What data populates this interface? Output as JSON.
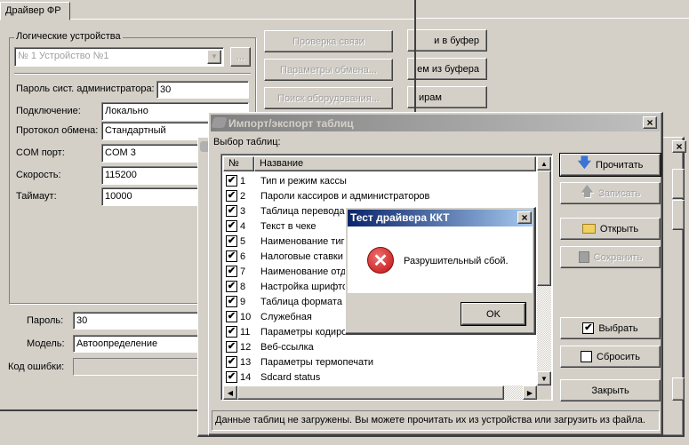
{
  "main_window": {
    "tab": "Драйвер ФР",
    "group_title": "Логические устройства",
    "device_combo": "№ 1 Устройство №1",
    "ellipsis_button": "...",
    "admin_password_label": "Пароль сист. администратора:",
    "admin_password": "30",
    "connection_label": "Подключение:",
    "connection": "Локально",
    "protocol_label": "Протокол обмена:",
    "protocol": "Стандартный",
    "com_label": "COM порт:",
    "com": "COM 3",
    "speed_label": "Скорость:",
    "speed": "115200",
    "timeout_label": "Таймаут:",
    "timeout": "10000",
    "buttons": [
      "Проверка связи",
      "Параметры обмена...",
      "Поиск оборудования..."
    ],
    "password_label": "Пароль:",
    "password": "30",
    "model_label": "Модель:",
    "model": "Автоопределение",
    "error_code_label": "Код ошибки:",
    "error_code": ""
  },
  "background_window": {
    "buttons": [
      "и в буфер",
      "ем из буфера",
      "ирам"
    ]
  },
  "import_dialog": {
    "title": "Импорт/экспорт таблиц",
    "select_label": "Выбор таблиц:",
    "columns": [
      "№",
      "Название"
    ],
    "rows": [
      {
        "n": "1",
        "name": "Тип и режим кассы",
        "checked": true
      },
      {
        "n": "2",
        "name": "Пароли кассиров и администраторов",
        "checked": true
      },
      {
        "n": "3",
        "name": "Таблица перевода",
        "checked": true
      },
      {
        "n": "4",
        "name": "Текст в чеке",
        "checked": true
      },
      {
        "n": "5",
        "name": "Наименование тиг",
        "checked": true
      },
      {
        "n": "6",
        "name": "Налоговые ставки",
        "checked": true
      },
      {
        "n": "7",
        "name": "Наименование отд",
        "checked": true
      },
      {
        "n": "8",
        "name": "Настройка шрифто",
        "checked": true
      },
      {
        "n": "9",
        "name": "Таблица формата",
        "checked": true
      },
      {
        "n": "10",
        "name": "Служебная",
        "checked": true
      },
      {
        "n": "11",
        "name": "Параметры кодиро",
        "checked": true
      },
      {
        "n": "12",
        "name": "Веб-ссылка",
        "checked": true
      },
      {
        "n": "13",
        "name": "Параметры термопечати",
        "checked": true
      },
      {
        "n": "14",
        "name": "Sdcard status",
        "checked": true
      }
    ],
    "buttons": {
      "read": "Прочитать",
      "write": "Записать",
      "open": "Открыть",
      "save": "Сохранить",
      "select": "Выбрать",
      "reset": "Сбросить",
      "close": "Закрыть"
    },
    "status": "Данные таблиц не загружены. Вы можете прочитать их из устройства или загрузить из файла."
  },
  "error_dialog": {
    "title": "Тест драйвера ККТ",
    "message": "Разрушительный сбой.",
    "ok": "OK",
    "title_color_start": "#0a246a",
    "title_color_end": "#a6caf0"
  }
}
